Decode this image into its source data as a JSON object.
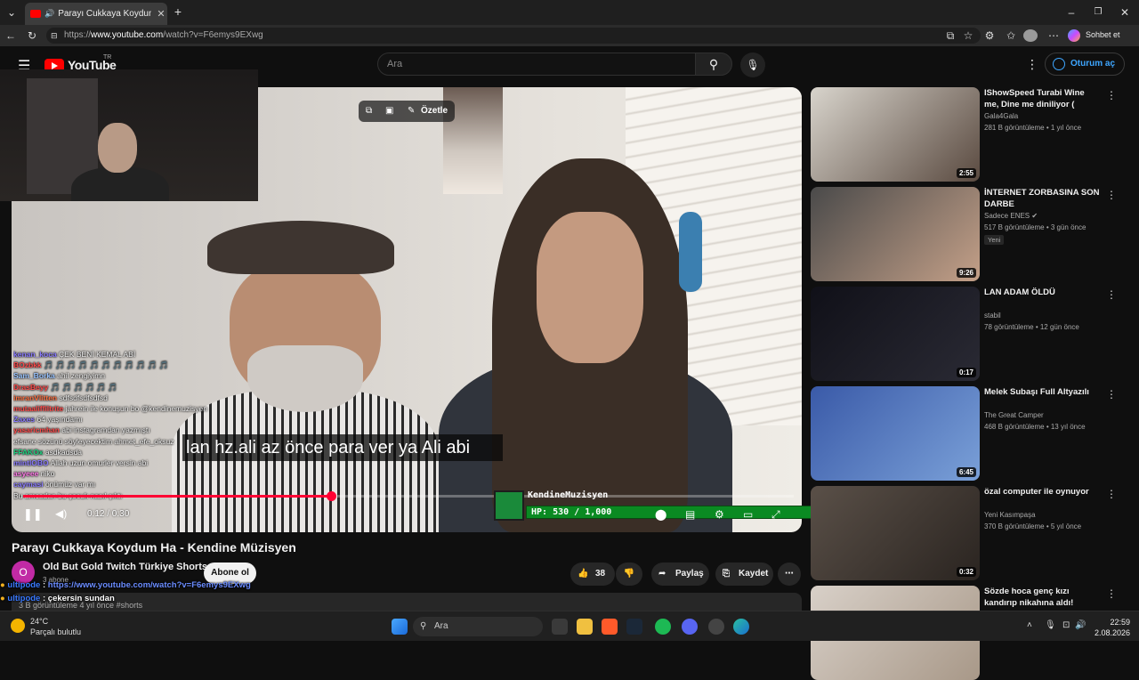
{
  "browser": {
    "tab_title": "Parayı Cukkaya Koydum Ha - ",
    "new_tab": "+",
    "url_prefix": "https://",
    "url_host": "www.youtube.com",
    "url_path": "/watch?v=F6emys9EXwg",
    "copilot_label": "Sohbet et"
  },
  "youtube": {
    "logo": "YouTube",
    "region": "TR",
    "search_placeholder": "Ara",
    "signin_label": "Oturum aç"
  },
  "player": {
    "summarize_label": "Özetle",
    "subtitle": "lan hz.ali az önce para ver ya Ali abi",
    "time": "0:12 / 0:30",
    "progress_fraction": 0.4,
    "overlay_name": "KendineMuzisyen",
    "hp_text": "HP: 530 / 1,000",
    "hp_fraction": 0.53
  },
  "stream_chat": [
    {
      "user": "kenan_koca",
      "user_color": "#8a7bff",
      "msg": "ÇEK BENİ KEMAL ABİ"
    },
    {
      "user": "BOzbkk",
      "user_color": "#ff4a4a",
      "msg": "🎵 🎵 🎵 🎵 🎵 🎵 🎵 🎵 🎵 🎵 🎵"
    },
    {
      "user": "Sam_Borka",
      "user_color": "#9ac4ff",
      "msg": "ahil zengiyimn"
    },
    {
      "user": "DrasBeyy",
      "user_color": "#ff4a4a",
      "msg": "🎵 🎵 🎵 🎵 🎵 🎵"
    },
    {
      "user": "imranVlitten",
      "user_color": "#ff7040",
      "msg": "sdfsdfsdfsdfsd"
    },
    {
      "user": "mutaaliffiltrite",
      "user_color": "#ff4a4a",
      "msg": "jahrein ile konuşun bo @kendinemuzisyen"
    },
    {
      "user": "Zaxes",
      "user_color": "#8a7bff",
      "msg": "64 yaşındamı"
    },
    {
      "user": "yasaricmhan",
      "user_color": "#ff4a4a",
      "msg": "abi instagramdan yazmıştı"
    },
    {
      "user": "",
      "user_color": "#ffffff",
      "msg": "efsane sözünü söyleyecektim ahmet_efe_oksuz"
    },
    {
      "user": "FFAKOx",
      "user_color": "#20d080",
      "msg": "asdkadsda"
    },
    {
      "user": "mintlOBO",
      "user_color": "#8a7bff",
      "msg": "Allah uzun omurler versin abi"
    },
    {
      "user": "asyeee",
      "user_color": "#ff7ae8",
      "msg": "niko"
    },
    {
      "user": "caymasi",
      "user_color": "#8a7bff",
      "msg": "önümüz var mı"
    },
    {
      "user": "",
      "user_color": "#ffffff",
      "msg": "Bu amcadan bu çocuk nasıl çıktı"
    }
  ],
  "video": {
    "title": "Parayı Cukkaya Koydum Ha - Kendine Müzisyen",
    "channel": "Old But Gold Twitch Türkiye Shorts",
    "channel_initial": "O",
    "subscribers": "3 abone",
    "subscribe_label": "Abone ol",
    "likes": "38",
    "share_label": "Paylaş",
    "save_label": "Kaydet",
    "views_line": "3 B görüntüleme  4 yıl önce  #shorts"
  },
  "overlay_chat": [
    {
      "user": "ultipode",
      "user_color": "#3a7aff",
      "msg": "https://www.youtube.com/watch?v=F6emys9EXwg",
      "msg_color": "#6a8cff"
    },
    {
      "user": "ultipode",
      "user_color": "#3a7aff",
      "msg": "çekersin sundan",
      "msg_color": "#ffffff"
    }
  ],
  "recommended": [
    {
      "title": "IShowSpeed Turabi Wine me, Dine me diniliyor ( Thanks ...",
      "channel": "Gala4Gala",
      "verified": false,
      "meta": "281 B görüntüleme • 1 yıl önce",
      "duration": "2:55",
      "badge": "",
      "thumb_colors": [
        "#d8d4cc",
        "#5a4a40"
      ]
    },
    {
      "title": "İNTERNET ZORBASINA SON DARBE",
      "channel": "Sadece ENES",
      "verified": true,
      "meta": "517 B görüntüleme • 3 gün önce",
      "duration": "9:26",
      "badge": "Yeni",
      "thumb_colors": [
        "#4a4a4a",
        "#c4a088"
      ]
    },
    {
      "title": "LAN ADAM ÖLDÜ",
      "channel": "stabil",
      "verified": false,
      "meta": "78 görüntüleme • 12 gün önce",
      "duration": "0:17",
      "badge": "",
      "thumb_colors": [
        "#101018",
        "#2a2a34"
      ]
    },
    {
      "title": "Melek Subaşı Full Altyazılı",
      "channel": "The Great Camper",
      "verified": false,
      "meta": "468 B görüntüleme • 13 yıl önce",
      "duration": "6:45",
      "badge": "",
      "thumb_colors": [
        "#3a5aa8",
        "#7aa0d8"
      ]
    },
    {
      "title": "özal computer ile oynuyor",
      "channel": "Yeni Kasımpaşa",
      "verified": false,
      "meta": "370 B görüntüleme • 5 yıl önce",
      "duration": "0:32",
      "badge": "",
      "thumb_colors": [
        "#5a5048",
        "#2a2420"
      ]
    },
    {
      "title": "Sözde hoca genç kızı kandırıp nikahına aldı!",
      "channel": "",
      "verified": false,
      "meta": "",
      "duration": "",
      "badge": "",
      "thumb_colors": [
        "#d8d0c8",
        "#a89888"
      ]
    }
  ],
  "taskbar": {
    "temp": "24°C",
    "weather": "Parçalı bulutlu",
    "search_label": "Ara",
    "time": "22:59",
    "date": "2.08.2026"
  }
}
